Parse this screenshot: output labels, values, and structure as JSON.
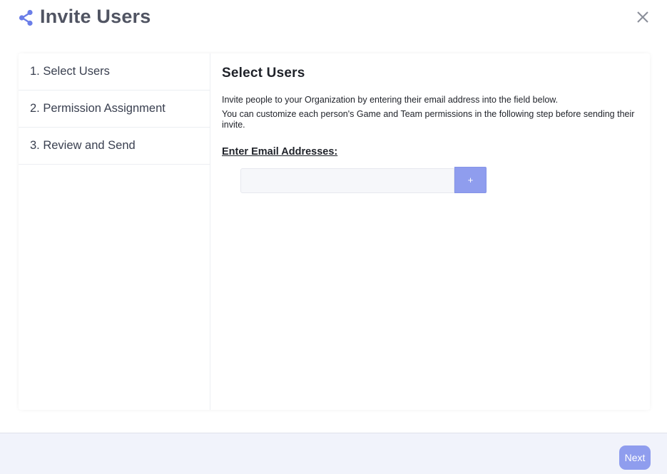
{
  "colors": {
    "accent": "#6b7ee8",
    "button": "#8f9dee",
    "title": "#505462",
    "footer_bg": "#f1f3fb"
  },
  "header": {
    "icon": "share-icon",
    "title": "Invite Users",
    "close_icon": "close-icon"
  },
  "sidebar": {
    "steps": [
      {
        "label": "1. Select Users"
      },
      {
        "label": "2. Permission Assignment"
      },
      {
        "label": "3. Review and Send"
      }
    ]
  },
  "main": {
    "title": "Select Users",
    "description": [
      "Invite people to your Organization by entering their email address into the field below.",
      "You can customize each person's Game and Team permissions in the following step before sending their invite."
    ],
    "email_label": "Enter Email Addresses:",
    "email_value": "",
    "email_placeholder": "",
    "add_button_label": "+"
  },
  "footer": {
    "next_label": "Next"
  }
}
